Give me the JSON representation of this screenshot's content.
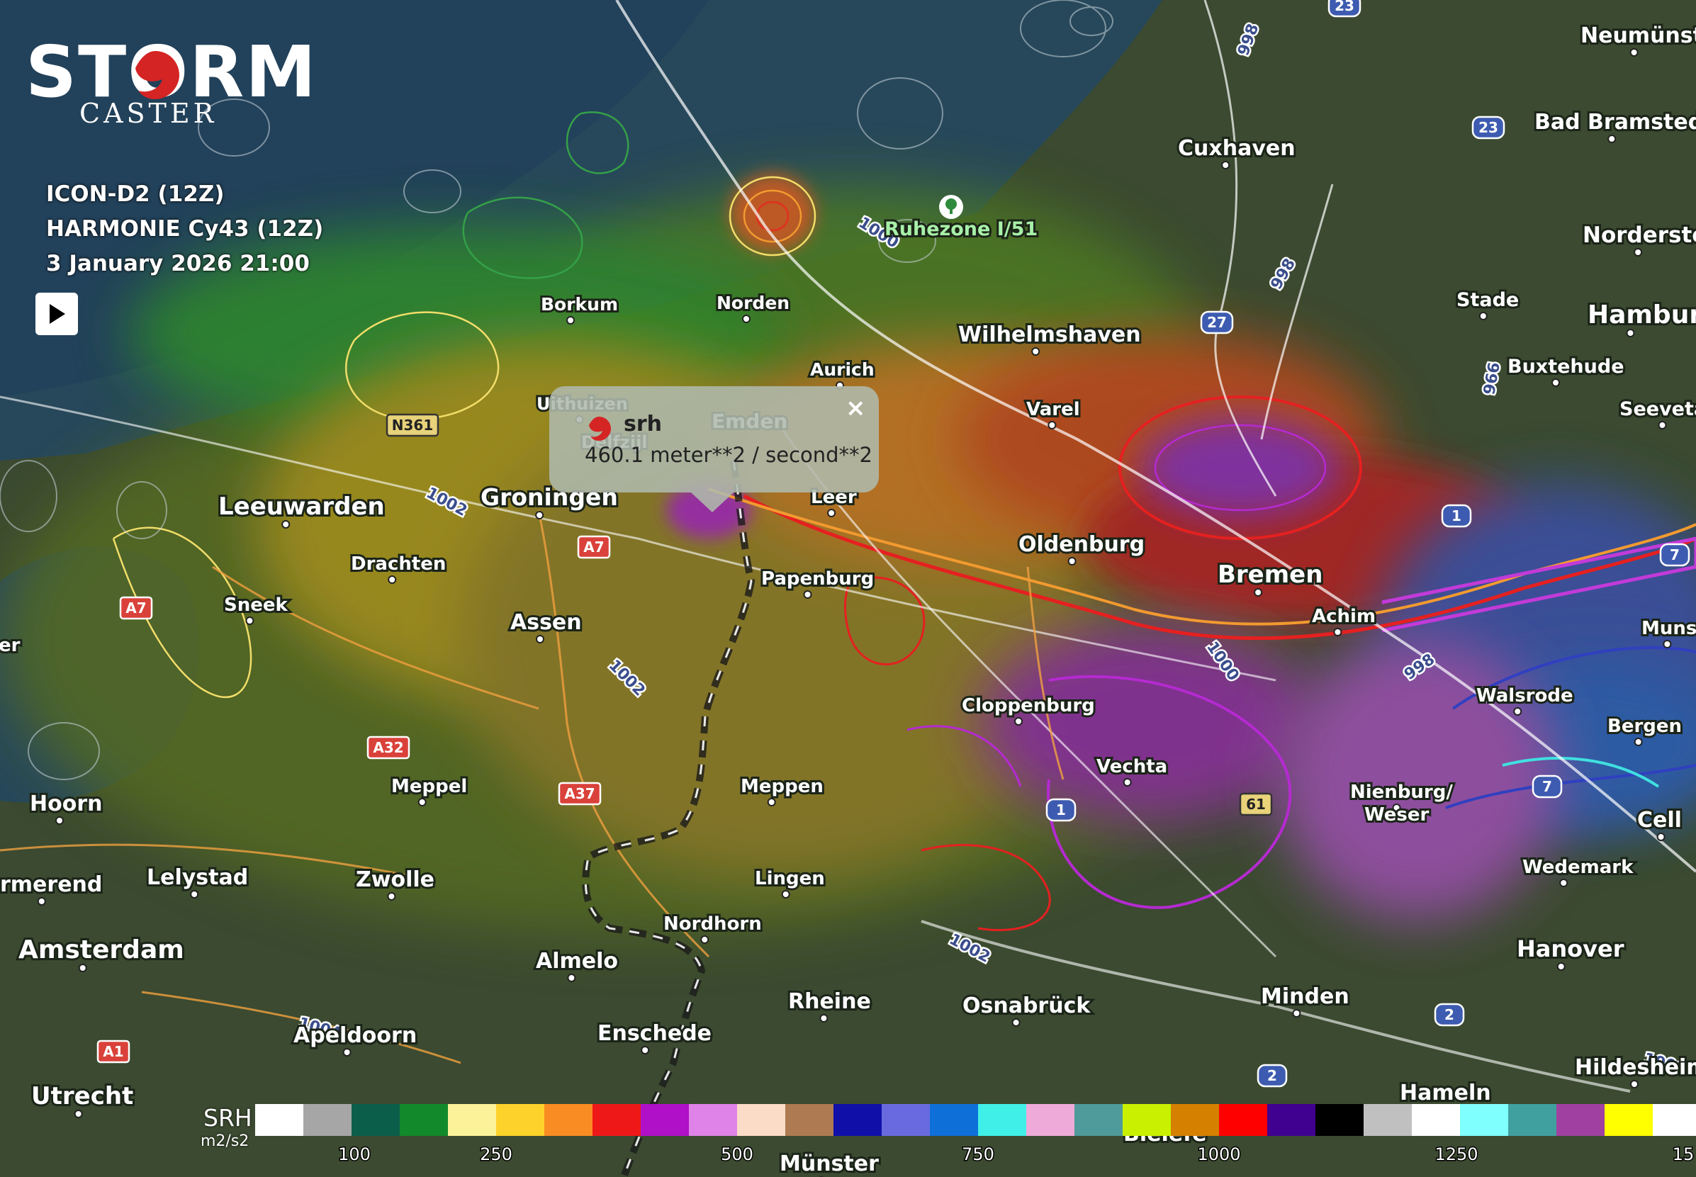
{
  "app": {
    "logo_main": "STORM",
    "logo_sub": "CASTER"
  },
  "info": {
    "model_1": "ICON-D2 (12Z)",
    "model_2": "HARMONIE Cy43 (12Z)",
    "valid_time": "3 January 2026 21:00"
  },
  "controls": {
    "play_icon": "play-icon"
  },
  "popup": {
    "title": "srh",
    "value": "460.1 meter**2 / second**2",
    "close_label": "×",
    "icon": "stormcaster-marker-icon"
  },
  "legend": {
    "label": "SRH",
    "unit": "m2/s2",
    "ticks": [
      "100",
      "250",
      "500",
      "750",
      "1000",
      "1250",
      "15"
    ],
    "colors": [
      "#ffffff",
      "#a6a6a6",
      "#0b5e4a",
      "#128a2c",
      "#fcf29a",
      "#fdd22b",
      "#f98c22",
      "#ef1818",
      "#b010c8",
      "#e083e8",
      "#fbdcc6",
      "#ad7a52",
      "#1010a8",
      "#6a6ae0",
      "#0f6fd8",
      "#40f0e8",
      "#eeaad8",
      "#4f9a9a",
      "#c8f000",
      "#d68000",
      "#ff0000",
      "#400090",
      "#000000",
      "#c0c0c0",
      "#ffffff",
      "#80ffff",
      "#40a0a0",
      "#a040a0",
      "#ffff00",
      "#ffffff"
    ]
  },
  "map": {
    "cities": [
      {
        "name": "Neumünste"
      },
      {
        "name": "Bad Bramstedt"
      },
      {
        "name": "Cuxhaven"
      },
      {
        "name": "Norderste"
      },
      {
        "name": "Ruhezone I/51"
      },
      {
        "name": "Stade"
      },
      {
        "name": "Hambur"
      },
      {
        "name": "Buxtehude"
      },
      {
        "name": "Seevetal"
      },
      {
        "name": "Borkum"
      },
      {
        "name": "Norden"
      },
      {
        "name": "Wilhelmshaven"
      },
      {
        "name": "Aurich"
      },
      {
        "name": "Uithuizen"
      },
      {
        "name": "Delfzijl"
      },
      {
        "name": "Emden"
      },
      {
        "name": "Varel"
      },
      {
        "name": "Leer"
      },
      {
        "name": "Leeuwarden"
      },
      {
        "name": "Groningen"
      },
      {
        "name": "Oldenburg"
      },
      {
        "name": "Bremen"
      },
      {
        "name": "Achim"
      },
      {
        "name": "Drachten"
      },
      {
        "name": "Papenburg"
      },
      {
        "name": "Sneek"
      },
      {
        "name": "Assen"
      },
      {
        "name": "Munst"
      },
      {
        "name": "Walsrode"
      },
      {
        "name": "Cloppenburg"
      },
      {
        "name": "Bergen"
      },
      {
        "name": "Vechta"
      },
      {
        "name": "Hoorn"
      },
      {
        "name": "Meppel"
      },
      {
        "name": "Meppen"
      },
      {
        "name": "Nienburg/"
      },
      {
        "name": "Weser"
      },
      {
        "name": "Cell"
      },
      {
        "name": "Wedemark"
      },
      {
        "name": "Lelystad"
      },
      {
        "name": "Zwolle"
      },
      {
        "name": "Lingen"
      },
      {
        "name": "rmerend"
      },
      {
        "name": "Nordhorn"
      },
      {
        "name": "Amsterdam"
      },
      {
        "name": "Hanover"
      },
      {
        "name": "Almelo"
      },
      {
        "name": "Rheine"
      },
      {
        "name": "Osnabrück"
      },
      {
        "name": "Minden"
      },
      {
        "name": "Apeldoorn"
      },
      {
        "name": "Enschede"
      },
      {
        "name": "Hildesheim"
      },
      {
        "name": "Utrecht"
      },
      {
        "name": "Hameln"
      },
      {
        "name": "Bielefe"
      },
      {
        "name": "Münster"
      },
      {
        "name": "er"
      }
    ],
    "road_shields": [
      {
        "label": "23"
      },
      {
        "label": "23"
      },
      {
        "label": "27"
      },
      {
        "label": "1"
      },
      {
        "label": "7"
      },
      {
        "label": "1"
      },
      {
        "label": "7"
      },
      {
        "label": "2"
      },
      {
        "label": "2"
      },
      {
        "label": "N361"
      },
      {
        "label": "A7"
      },
      {
        "label": "A7"
      },
      {
        "label": "A32"
      },
      {
        "label": "A37"
      },
      {
        "label": "61"
      },
      {
        "label": "A1"
      }
    ],
    "road_numbers": [
      {
        "label": "998"
      },
      {
        "label": "998"
      },
      {
        "label": "1000"
      },
      {
        "label": "966"
      },
      {
        "label": "1002"
      },
      {
        "label": "1002"
      },
      {
        "label": "1000"
      },
      {
        "label": "998"
      },
      {
        "label": "1002"
      },
      {
        "label": "1004"
      },
      {
        "label": "1000"
      }
    ]
  }
}
